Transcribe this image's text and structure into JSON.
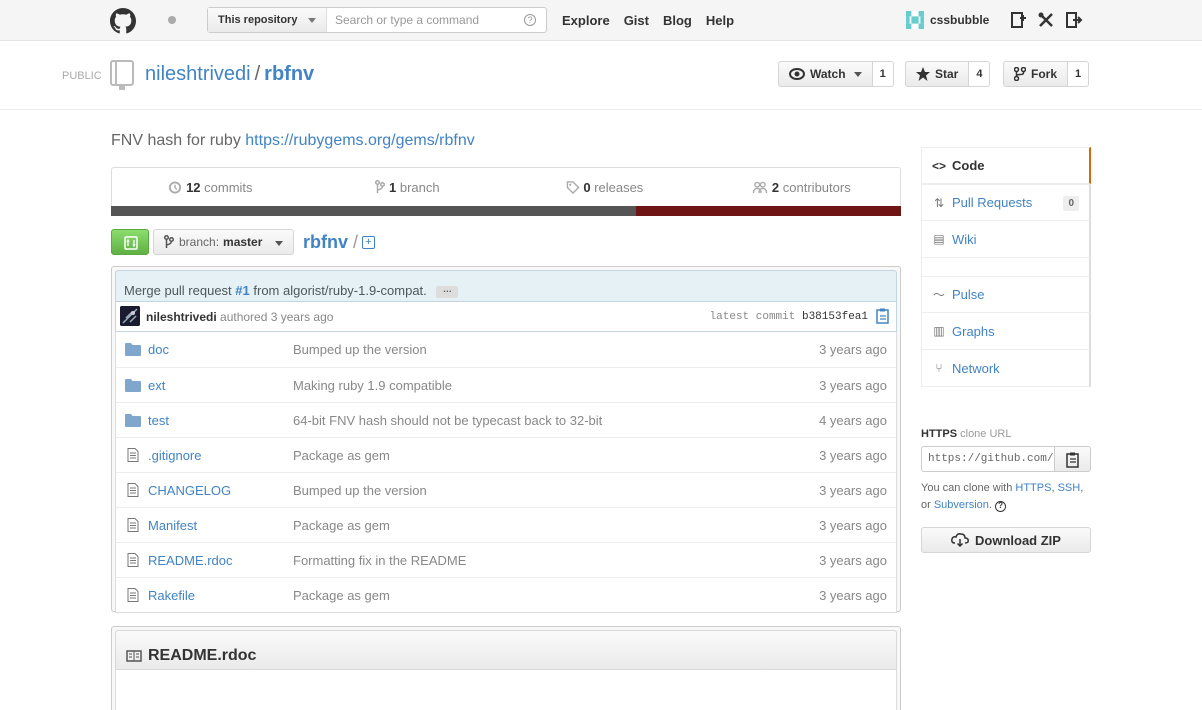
{
  "header": {
    "search_scope": "This repository",
    "search_placeholder": "Search or type a command",
    "nav": [
      "Explore",
      "Gist",
      "Blog",
      "Help"
    ],
    "username": "cssbubble"
  },
  "repo": {
    "visibility": "PUBLIC",
    "owner": "nileshtrivedi",
    "separator": "/",
    "name": "rbfnv",
    "watch_label": "Watch",
    "watch_count": "1",
    "star_label": "Star",
    "star_count": "4",
    "fork_label": "Fork",
    "fork_count": "1"
  },
  "description": {
    "text": "FNV hash for ruby",
    "link": "https://rubygems.org/gems/rbfnv"
  },
  "stats": {
    "commits_num": "12",
    "commits_label": "commits",
    "branch_num": "1",
    "branch_label": "branch",
    "releases_num": "0",
    "releases_label": "releases",
    "contributors_num": "2",
    "contributors_label": "contributors"
  },
  "languages": [
    {
      "share": 0.665,
      "color": "#555555"
    },
    {
      "share": 0.335,
      "color": "#701516"
    }
  ],
  "filenav": {
    "branch_prefix": "branch:",
    "branch": "master",
    "crumb": "rbfnv",
    "crumb_sep": "/",
    "add": "+"
  },
  "commit": {
    "msg_prefix": "Merge pull request",
    "pr": "#1",
    "msg_suffix": "from algorist/ruby-1.9-compat.",
    "ellipsis": "…",
    "author": "nileshtrivedi",
    "authored": "authored 3 years ago",
    "latest_label": "latest commit",
    "sha": "b38153fea1"
  },
  "files": [
    {
      "type": "dir",
      "name": "doc",
      "message": "Bumped up the version",
      "age": "3 years ago"
    },
    {
      "type": "dir",
      "name": "ext",
      "message": "Making ruby 1.9 compatible",
      "age": "3 years ago"
    },
    {
      "type": "dir",
      "name": "test",
      "message": "64-bit FNV hash should not be typecast back to 32-bit",
      "age": "4 years ago"
    },
    {
      "type": "file",
      "name": ".gitignore",
      "message": "Package as gem",
      "age": "3 years ago"
    },
    {
      "type": "file",
      "name": "CHANGELOG",
      "message": "Bumped up the version",
      "age": "3 years ago"
    },
    {
      "type": "file",
      "name": "Manifest",
      "message": "Package as gem",
      "age": "3 years ago"
    },
    {
      "type": "file",
      "name": "README.rdoc",
      "message": "Formatting fix in the README",
      "age": "3 years ago"
    },
    {
      "type": "file",
      "name": "Rakefile",
      "message": "Package as gem",
      "age": "3 years ago"
    }
  ],
  "readme": {
    "title": "README.rdoc"
  },
  "sidebar": {
    "code": "Code",
    "pull_requests": "Pull Requests",
    "pull_requests_count": "0",
    "wiki": "Wiki",
    "pulse": "Pulse",
    "graphs": "Graphs",
    "network": "Network",
    "clone_proto": "HTTPS",
    "clone_label": "clone URL",
    "clone_url": "https://github.com/nileshtrivedi/rbfnv.git",
    "help_prefix": "You can clone with",
    "help_https": "HTTPS",
    "help_ssh": "SSH",
    "help_or": "or",
    "help_svn": "Subversion",
    "help_q": "?",
    "download_zip": "Download ZIP"
  }
}
